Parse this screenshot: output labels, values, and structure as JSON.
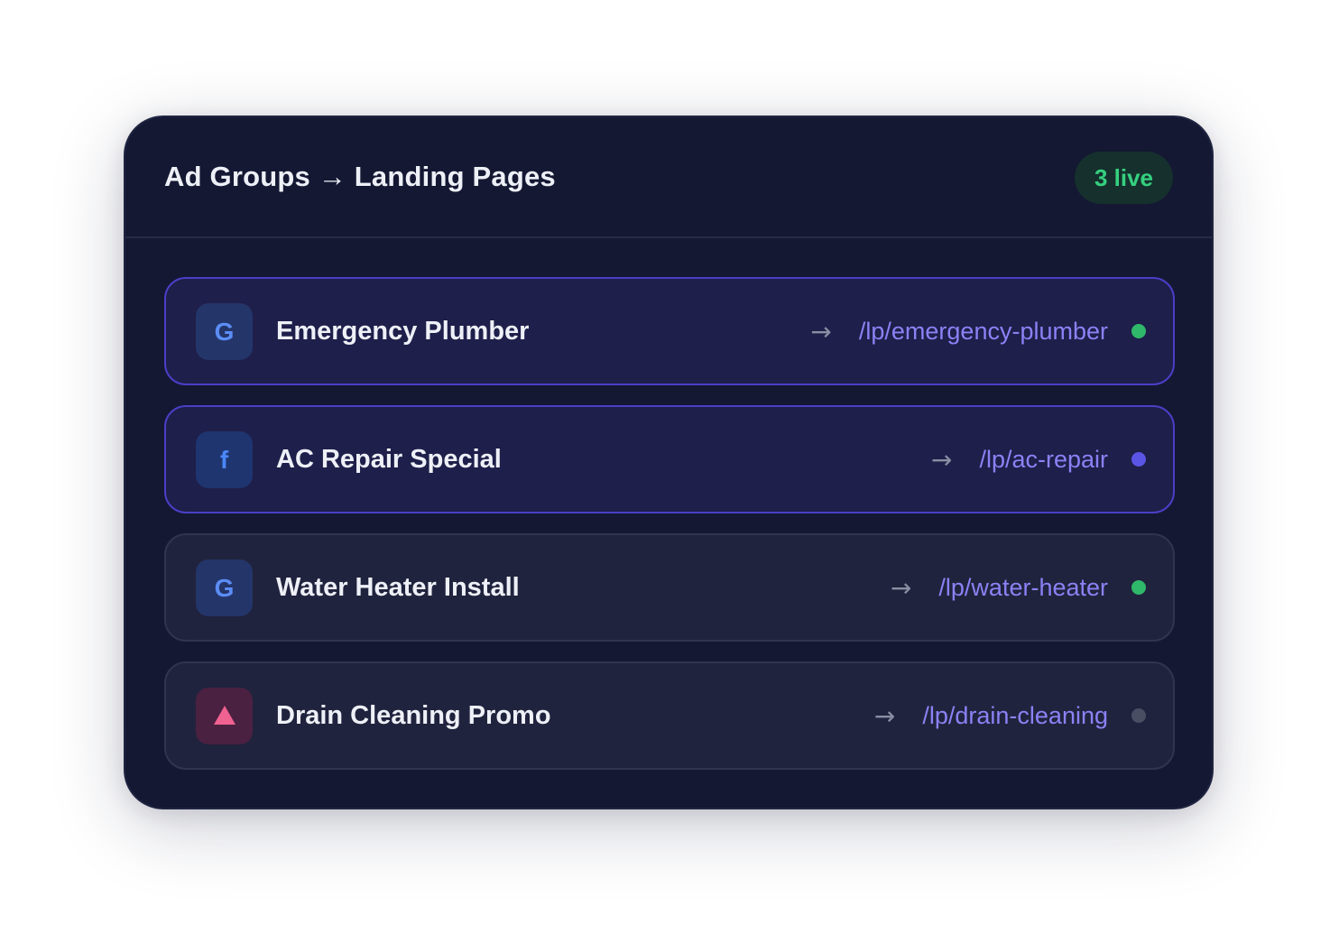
{
  "header": {
    "title": "Ad Groups → Landing Pages",
    "badge": "3 live"
  },
  "colors": {
    "live": "#2fb86a",
    "active": "#5b55e6",
    "inactive": "#4a4e63",
    "accent": "#8b82f5"
  },
  "ad_groups": [
    {
      "icon": "google-icon",
      "icon_glyph": "G",
      "name": "Emergency Plumber",
      "arrow": "→",
      "url": "/lp/emergency-plumber",
      "status_color": "#2fb86a",
      "highlighted": true
    },
    {
      "icon": "facebook-icon",
      "icon_glyph": "f",
      "name": "AC Repair Special",
      "arrow": "→",
      "url": "/lp/ac-repair",
      "status_color": "#5b55e6",
      "highlighted": true
    },
    {
      "icon": "google-icon",
      "icon_glyph": "G",
      "name": "Water Heater Install",
      "arrow": "→",
      "url": "/lp/water-heater",
      "status_color": "#2fb86a",
      "highlighted": false
    },
    {
      "icon": "triangle-icon",
      "icon_glyph": "",
      "name": "Drain Cleaning Promo",
      "arrow": "→",
      "url": "/lp/drain-cleaning",
      "status_color": "#4a4e63",
      "highlighted": false
    }
  ]
}
